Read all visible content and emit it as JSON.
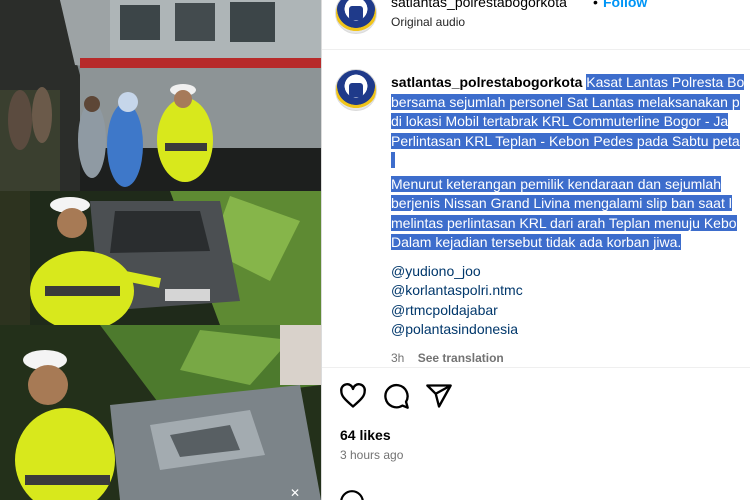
{
  "header": {
    "username": "satlantas_polrestabogorkota",
    "separator": "•",
    "follow_label": "Follow",
    "audio_label": "Original audio"
  },
  "caption": {
    "username": "satlantas_polrestabogorkota",
    "lines": [
      "Kasat Lantas Polresta Bo",
      "bersama sejumlah personel Sat Lantas melaksanakan p",
      "di lokasi Mobil tertabrak KRL Commuterline Bogor - Ja",
      "Perlintasan KRL Teplan - Kebon Pedes pada Sabtu peta",
      "Menurut keterangan pemilik kendaraan dan sejumlah",
      "berjenis Nissan Grand Livina mengalami slip ban saat l",
      "melintas perlintasan KRL dari arah Teplan menuju Kebo",
      "Dalam kejadian tersebut tidak ada korban jiwa."
    ],
    "mentions": [
      "@yudiono_joo",
      "@korlantaspolri.ntmc",
      "@rtmcpoldajabar",
      "@polantasindonesia"
    ]
  },
  "meta": {
    "time_short": "3h",
    "see_translation": "See translation"
  },
  "actions": {
    "like_icon": "heart-icon",
    "comment_icon": "comment-icon",
    "share_icon": "share-icon"
  },
  "likes_label": "64 likes",
  "posted_ago": "3 hours ago",
  "colors": {
    "follow": "#0095f6",
    "highlight": "#3d6dcc",
    "mention": "#00376b",
    "muted": "#737373",
    "police_vest": "#d8e81c"
  }
}
